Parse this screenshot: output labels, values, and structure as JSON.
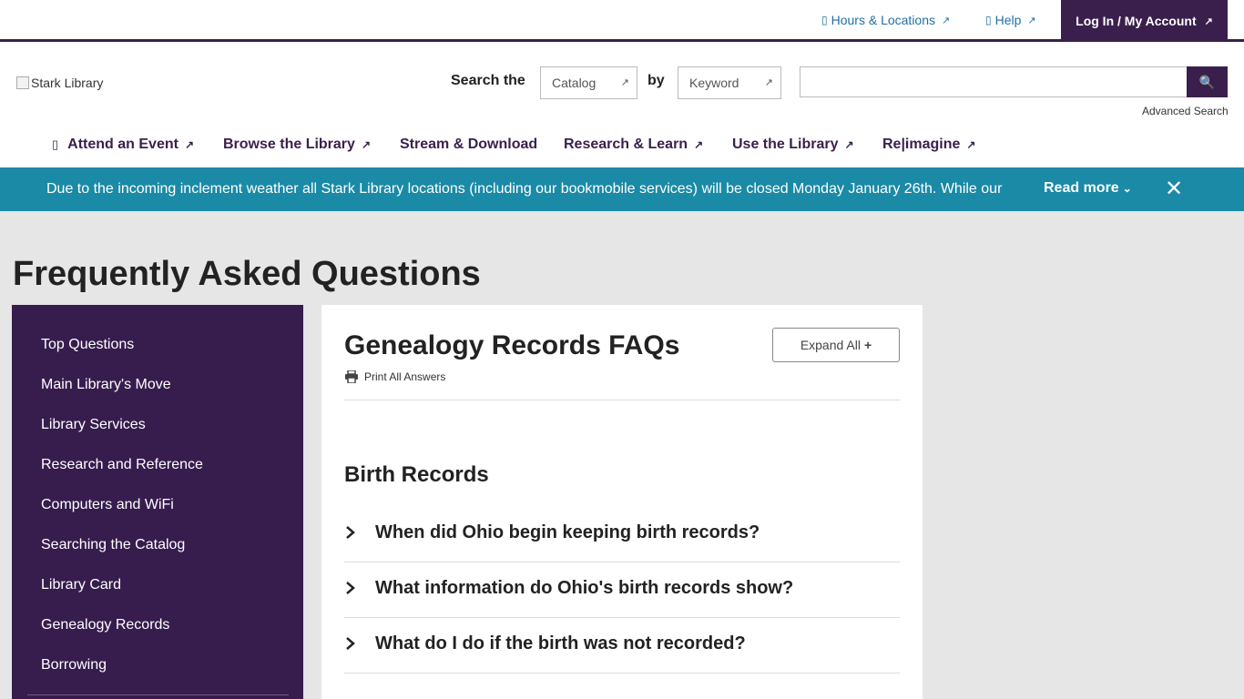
{
  "util": {
    "hours": "Hours & Locations",
    "help": "Help",
    "login": "Log In / My Account"
  },
  "logo_alt": "Stark Library",
  "search": {
    "label": "Search the",
    "scope": "Catalog",
    "by_label": "by",
    "field": "Keyword",
    "input_value": "",
    "advanced": "Advanced Search"
  },
  "nav": {
    "items": [
      {
        "label": "Attend an Event"
      },
      {
        "label": "Browse the Library"
      },
      {
        "label": "Stream & Download"
      },
      {
        "label": "Research & Learn"
      },
      {
        "label": "Use the Library"
      },
      {
        "label": "Re|imagine"
      }
    ]
  },
  "alert": {
    "text": "Due to the incoming inclement weather all Stark Library locations (including our bookmobile services) will be closed Monday January 26th. While our",
    "more": "Read more"
  },
  "page": {
    "title": "Frequently Asked Questions"
  },
  "sidebar": {
    "items": [
      {
        "label": "Top Questions"
      },
      {
        "label": "Main Library's Move"
      },
      {
        "label": "Library Services"
      },
      {
        "label": "Research and Reference"
      },
      {
        "label": "Computers and WiFi"
      },
      {
        "label": "Searching the Catalog"
      },
      {
        "label": "Library Card"
      },
      {
        "label": "Genealogy Records"
      },
      {
        "label": "Borrowing"
      }
    ]
  },
  "main": {
    "title": "Genealogy Records FAQs",
    "expand": "Expand All",
    "expand_icon": "+",
    "print": "Print All Answers",
    "section": "Birth Records",
    "questions": [
      {
        "text": "When did Ohio begin keeping birth records?"
      },
      {
        "text": "What information do Ohio's birth records show?"
      },
      {
        "text": "What do I do if the birth was not recorded?"
      }
    ]
  },
  "colors": {
    "brand_purple": "#3a1f4d",
    "sidebar_purple": "#371c4e",
    "alert_teal": "#1a8aa6",
    "link_blue": "#1f6fa3"
  }
}
